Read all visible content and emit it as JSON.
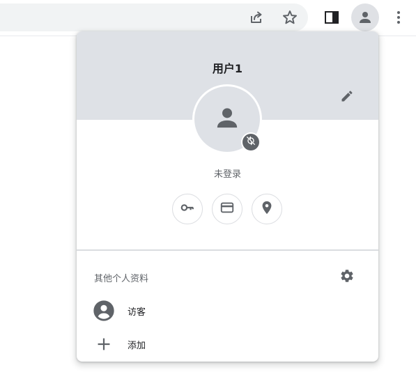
{
  "toolbar": {
    "icons": [
      "share-icon",
      "bookmark-star-icon",
      "side-panel-icon",
      "profile-icon",
      "more-vert-icon"
    ]
  },
  "profile_menu": {
    "profile_name": "用户1",
    "sync_status": "未登录",
    "quick_actions": [
      "passwords-key-icon",
      "payment-card-icon",
      "addresses-location-icon"
    ],
    "other_profiles_title": "其他个人资料",
    "guest_label": "访客",
    "add_label": "添加"
  },
  "colors": {
    "header_bg": "#dee1e6",
    "icon": "#5f6368",
    "active_toolbar_button": "#dfe1e5"
  }
}
